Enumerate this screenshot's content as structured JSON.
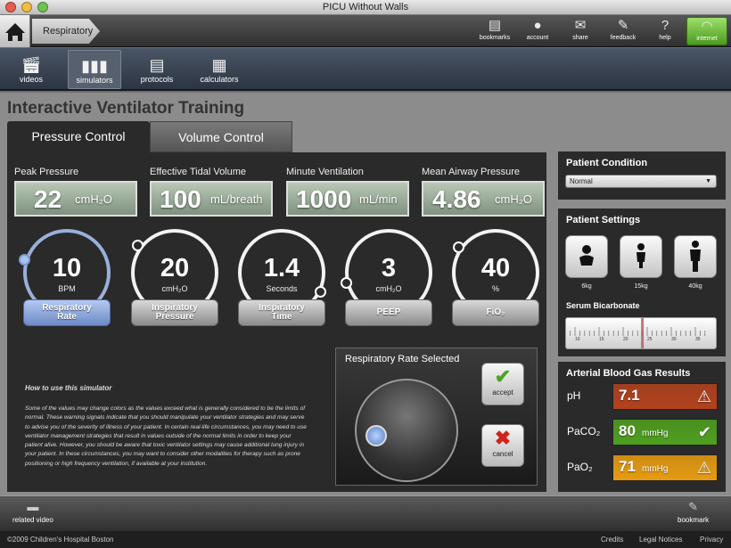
{
  "window": {
    "title": "PICU Without Walls"
  },
  "breadcrumb": {
    "label": "Respiratory"
  },
  "toolbar": [
    {
      "label": "bookmarks",
      "icon": "bookmarks-icon"
    },
    {
      "label": "account",
      "icon": "account-icon"
    },
    {
      "label": "share",
      "icon": "share-icon"
    },
    {
      "label": "feedback",
      "icon": "feedback-icon"
    },
    {
      "label": "help",
      "icon": "help-icon"
    },
    {
      "label": "internet",
      "icon": "wifi-icon"
    }
  ],
  "nav": [
    {
      "label": "videos",
      "icon": "clapper-icon"
    },
    {
      "label": "simulators",
      "icon": "bar-chart-icon",
      "active": true
    },
    {
      "label": "protocols",
      "icon": "document-icon"
    },
    {
      "label": "calculators",
      "icon": "calculator-icon"
    }
  ],
  "page": {
    "title": "Interactive Ventilator Training"
  },
  "tabs": [
    {
      "label": "Pressure Control",
      "active": true
    },
    {
      "label": "Volume Control",
      "active": false
    }
  ],
  "metrics": [
    {
      "label": "Peak Pressure",
      "value": "22",
      "unit": "cmH₂O"
    },
    {
      "label": "Effective Tidal Volume",
      "value": "100",
      "unit": "mL/breath"
    },
    {
      "label": "Minute Ventilation",
      "value": "1000",
      "unit": "mL/min"
    },
    {
      "label": "Mean Airway Pressure",
      "value": "4.86",
      "unit": "cmH₂O"
    }
  ],
  "dials": [
    {
      "value": "10",
      "unit": "BPM",
      "button": "Respiratory Rate",
      "selected": true
    },
    {
      "value": "20",
      "unit": "cmH₂O",
      "button": "Inspiratory Pressure",
      "selected": false
    },
    {
      "value": "1.4",
      "unit": "Seconds",
      "button": "Inspiratory Time",
      "selected": false
    },
    {
      "value": "3",
      "unit": "cmH₂O",
      "button": "PEEP",
      "selected": false
    },
    {
      "value": "40",
      "unit": "%",
      "button": "FiO₂",
      "selected": false
    }
  ],
  "howto": {
    "title": "How to use this simulator",
    "body": "Some of the values may change colors as the values exceed what is generally considered to be the limits of normal. These warning signals indicate that you should manipulate your ventilator strategies and may serve to advise you of the severity of illness of your patient. In certain real-life circumstances, you may need to use ventilator management strategies that result in values outside of the normal limits in order to keep your patient alive. However, you should be aware that toxic ventilator settings may cause additional lung injury in your patient. In these circumstances, you may want to consider other modalities for therapy such as prone positioning or high frequency ventilation, if available at your institution."
  },
  "selector": {
    "title": "Respiratory Rate Selected",
    "accept": "accept",
    "cancel": "cancel"
  },
  "condition": {
    "title": "Patient Condition",
    "selected": "Normal"
  },
  "settings": {
    "title": "Patient Settings",
    "weights": [
      "6kg",
      "15kg",
      "40kg"
    ],
    "bicarb_title": "Serum Bicarbonate",
    "ruler_ticks": [
      "10",
      "15",
      "20",
      "25",
      "30",
      "35"
    ],
    "bicarb_value": 24
  },
  "abg": {
    "title": "Arterial Blood Gas Results",
    "rows": [
      {
        "name": "pH",
        "value": "7.1",
        "unit": "",
        "status": "critical",
        "color": "#b2421e",
        "icon": "lightning-warning-icon"
      },
      {
        "name": "PaCO₂",
        "value": "80",
        "unit": "mmHg",
        "status": "normal",
        "color": "#4f9f1f",
        "icon": "check-icon"
      },
      {
        "name": "PaO₂",
        "value": "71",
        "unit": "mmHg",
        "status": "warning",
        "color": "#e69b12",
        "icon": "warning-icon"
      }
    ]
  },
  "bottom": {
    "related": "related video",
    "bookmark": "bookmark"
  },
  "footer": {
    "copyright": "©2009 Children's Hospital Boston",
    "links": [
      "Credits",
      "Legal Notices",
      "Privacy"
    ]
  }
}
